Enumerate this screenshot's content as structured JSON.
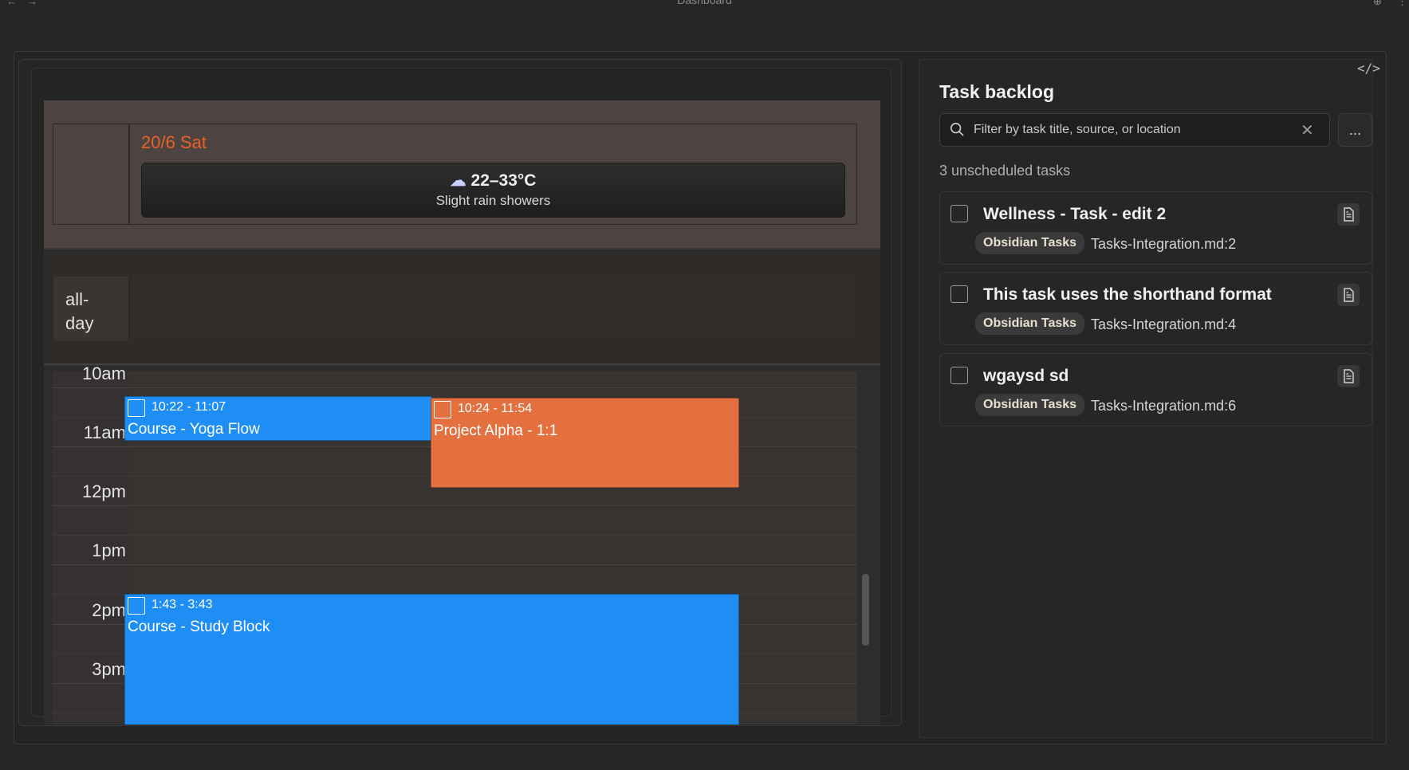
{
  "window": {
    "title": "Dashboard"
  },
  "calendar": {
    "date_label": "20/6 Sat",
    "weather": {
      "icon": "rain-cloud-icon",
      "temperature": "22–33°C",
      "description": "Slight rain showers"
    },
    "allday_label": "all-day",
    "time_labels": [
      "10am",
      "11am",
      "12pm",
      "1pm",
      "2pm",
      "3pm"
    ],
    "events": [
      {
        "time": "10:22 - 11:07",
        "title": "Course - Yoga Flow",
        "color": "#1e8ef5"
      },
      {
        "time": "10:24 - 11:54",
        "title": "Project Alpha - 1:1",
        "color": "#e4703f"
      },
      {
        "time": "1:43 - 3:43",
        "title": "Course - Study Block",
        "color": "#1e8ef5"
      }
    ]
  },
  "backlog": {
    "title": "Task backlog",
    "search_placeholder": "Filter by task title, source, or location",
    "more_label": "...",
    "count_label": "3 unscheduled tasks",
    "tasks": [
      {
        "title": "Wellness - Task - edit 2",
        "source": "Obsidian Tasks",
        "path": "Tasks-Integration.md:2"
      },
      {
        "title": "This task uses the shorthand format",
        "source": "Obsidian Tasks",
        "path": "Tasks-Integration.md:4"
      },
      {
        "title": "wgaysd sd",
        "source": "Obsidian Tasks",
        "path": "Tasks-Integration.md:6"
      }
    ]
  },
  "colors": {
    "accent_date": "#e8622a",
    "event_blue": "#1e8ef5",
    "event_orange": "#e4703f"
  }
}
